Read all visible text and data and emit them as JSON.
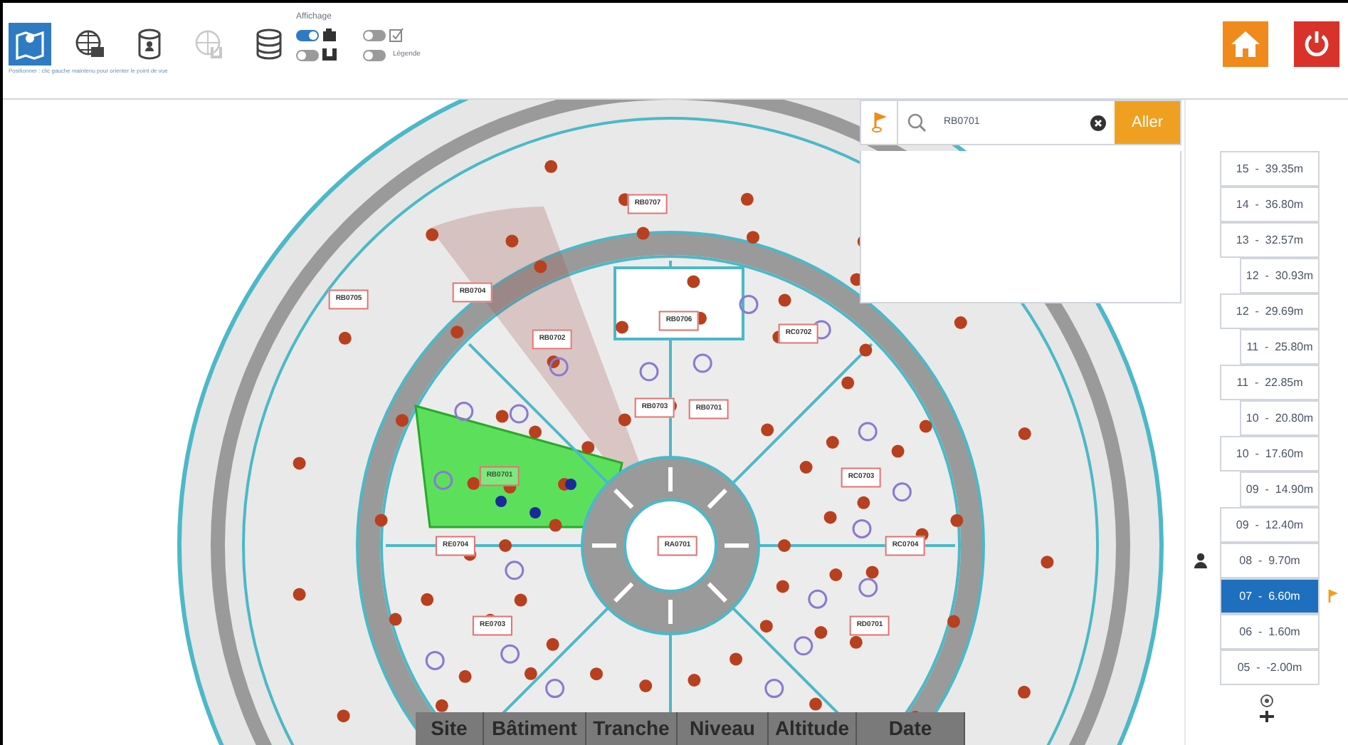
{
  "toolbar": {
    "tools": [
      {
        "selected": true,
        "disabled": false
      },
      {
        "selected": false,
        "disabled": false
      },
      {
        "selected": false,
        "disabled": false
      },
      {
        "selected": false,
        "disabled": true
      },
      {
        "selected": false,
        "disabled": false
      }
    ],
    "hint": "Positionner : clic gauche maintenu pour orienter le point de vue",
    "display": {
      "title": "Affichage",
      "toggles": [
        {
          "kind": "camera",
          "on": true
        },
        {
          "kind": "check",
          "on": false
        },
        {
          "kind": "sensor",
          "on": false
        },
        {
          "kind": "legend",
          "on": false,
          "label": "Légende"
        }
      ]
    }
  },
  "search": {
    "value": "RB0701",
    "button": "Aller"
  },
  "map": {
    "rooms": [
      {
        "label": "RB0707",
        "highlighted": false
      },
      {
        "label": "RB0705",
        "highlighted": false
      },
      {
        "label": "RB0704",
        "highlighted": false
      },
      {
        "label": "RB0702",
        "highlighted": false
      },
      {
        "label": "RB0706",
        "highlighted": false
      },
      {
        "label": "RC0702",
        "highlighted": false
      },
      {
        "label": "RB0703",
        "highlighted": false
      },
      {
        "label": "RB0701",
        "highlighted": false
      },
      {
        "label": "RB0701",
        "highlighted": true
      },
      {
        "label": "RC0703",
        "highlighted": false
      },
      {
        "label": "RE0704",
        "highlighted": false
      },
      {
        "label": "RA0701",
        "highlighted": false
      },
      {
        "label": "RC0704",
        "highlighted": false
      },
      {
        "label": "RE0703",
        "highlighted": false
      },
      {
        "label": "RD0701",
        "highlighted": false
      }
    ]
  },
  "levels": [
    {
      "label": "15  -  39.35m",
      "indented": false,
      "selected": false,
      "user_here": false,
      "target_here": false
    },
    {
      "label": "14  -  36.80m",
      "indented": false,
      "selected": false,
      "user_here": false,
      "target_here": false
    },
    {
      "label": "13  -  32.57m",
      "indented": false,
      "selected": false,
      "user_here": false,
      "target_here": false
    },
    {
      "label": "12  -  30.93m",
      "indented": true,
      "selected": false,
      "user_here": false,
      "target_here": false
    },
    {
      "label": "12  -  29.69m",
      "indented": false,
      "selected": false,
      "user_here": false,
      "target_here": false
    },
    {
      "label": "11  -  25.80m",
      "indented": true,
      "selected": false,
      "user_here": false,
      "target_here": false
    },
    {
      "label": "11  -  22.85m",
      "indented": false,
      "selected": false,
      "user_here": false,
      "target_here": false
    },
    {
      "label": "10  -  20.80m",
      "indented": true,
      "selected": false,
      "user_here": false,
      "target_here": false
    },
    {
      "label": "10  -  17.60m",
      "indented": false,
      "selected": false,
      "user_here": false,
      "target_here": false
    },
    {
      "label": "09  -  14.90m",
      "indented": true,
      "selected": false,
      "user_here": false,
      "target_here": false
    },
    {
      "label": "09  -  12.40m",
      "indented": false,
      "selected": false,
      "user_here": false,
      "target_here": false
    },
    {
      "label": "08  -  9.70m",
      "indented": false,
      "selected": false,
      "user_here": true,
      "target_here": false
    },
    {
      "label": "07  -  6.60m",
      "indented": false,
      "selected": true,
      "user_here": false,
      "target_here": true
    },
    {
      "label": "06  -  1.60m",
      "indented": false,
      "selected": false,
      "user_here": false,
      "target_here": false
    },
    {
      "label": "05  -  -2.00m",
      "indented": false,
      "selected": false,
      "user_here": false,
      "target_here": false
    }
  ],
  "info_bar": {
    "columns": [
      "Site",
      "Bâtiment",
      "Tranche",
      "Niveau",
      "Altitude",
      "Date"
    ]
  }
}
